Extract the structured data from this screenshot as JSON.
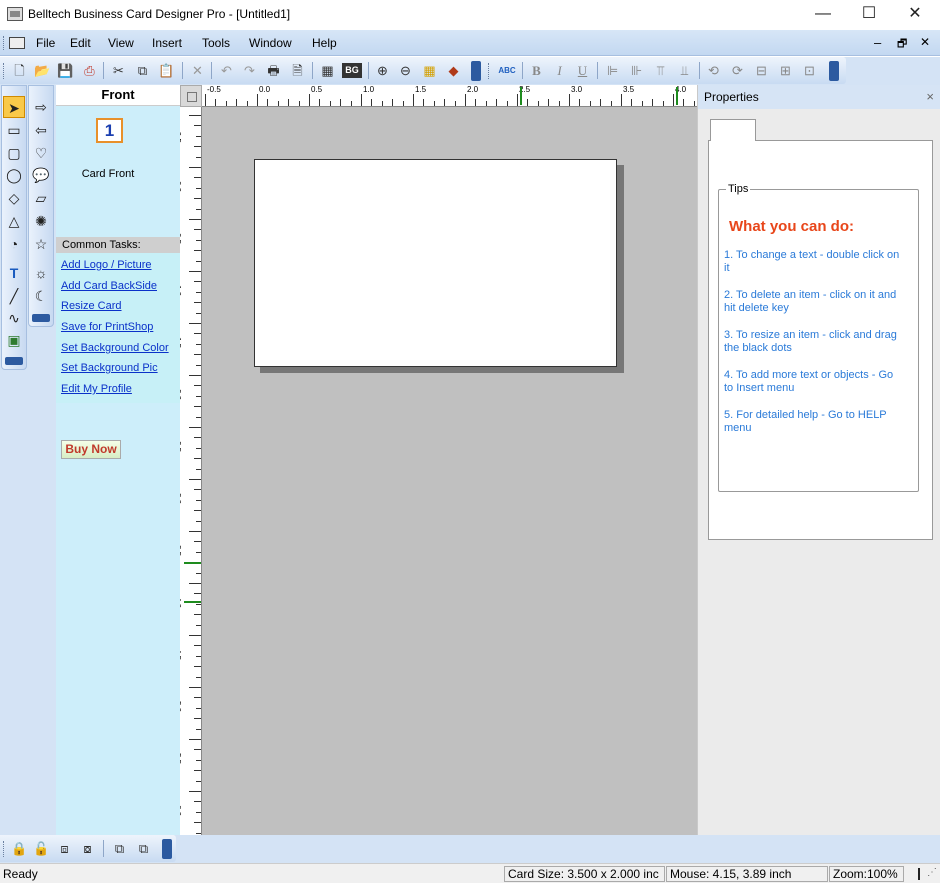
{
  "window": {
    "title": "Belltech Business Card Designer Pro  - [Untitled1]",
    "controls": {
      "minimize": "—",
      "maximize": "☐",
      "close": "✕"
    }
  },
  "menubar": {
    "items": [
      "File",
      "Edit",
      "View",
      "Insert",
      "Tools",
      "Window",
      "Help"
    ],
    "mdi_controls": {
      "minimize": "–",
      "restore": "🗗",
      "close": "✕"
    }
  },
  "toolbar": {
    "icons": [
      "new-icon",
      "open-icon",
      "save-icon",
      "pdf-icon",
      "cut-icon",
      "copy-icon",
      "paste-icon",
      "delete-icon",
      "undo-icon",
      "redo-icon",
      "print-icon",
      "print-preview-icon",
      "card-layout-icon",
      "background-icon",
      "zoom-in-icon",
      "zoom-out-icon",
      "grid-icon",
      "fill-icon",
      "spellcheck-icon",
      "bold-icon",
      "italic-icon",
      "underline-icon",
      "align-left-icon",
      "align-right-icon",
      "align-top-icon",
      "align-bottom-icon",
      "rotate-left-icon",
      "rotate-right-icon",
      "center-h-icon",
      "center-v-icon",
      "center-both-icon"
    ],
    "format_labels": {
      "spell": "ABC",
      "bold": "B",
      "italic": "I",
      "underline": "U"
    }
  },
  "drawing_tools": {
    "col1": [
      "pointer-icon",
      "rectangle-icon",
      "rounded-rectangle-icon",
      "ellipse-icon",
      "diamond-icon",
      "triangle-icon",
      "arc-icon",
      "text-icon",
      "line-icon",
      "curve-icon",
      "image-icon"
    ],
    "col2": [
      "arrow-right-icon",
      "arrow-left-icon",
      "callout-icon",
      "speech-bubble-icon",
      "parallelogram-icon",
      "burst-icon",
      "star-icon",
      "sun-icon",
      "moon-icon"
    ],
    "text_tool_label": "T"
  },
  "side_panel": {
    "header": "Front",
    "thumbnail": {
      "number": "1",
      "label": "Card Front"
    },
    "tasks_header": "Common Tasks:",
    "tasks": [
      "Add Logo / Picture",
      "Add Card BackSide",
      "Resize Card",
      "Save for PrintShop",
      "Set Background Color",
      "Set Background Pic",
      "Edit My Profile"
    ],
    "buy_now": "Buy Now"
  },
  "rulers": {
    "horizontal": [
      "-0.5",
      "0.0",
      "0.5",
      "1.0",
      "1.5",
      "2.0",
      "2.5",
      "3.0",
      "3.5",
      "4.0"
    ],
    "vertical": [
      "-0.5",
      "0.0",
      "0.5",
      "1.0",
      "1.5",
      "2.0",
      "2.5",
      "3.0",
      "3.5",
      "4.0",
      "4.5",
      "5.0",
      "5.5",
      "6.0"
    ]
  },
  "properties": {
    "title": "Properties",
    "close": "×",
    "tips_legend": "Tips",
    "tips_heading": "What you can do:",
    "tips": [
      "1. To change a text - double click on it",
      "2. To delete an item - click on it and hit delete key",
      "3. To resize an item - click and drag the black dots",
      "4. To add more text or objects - Go to Insert menu",
      "5. For detailed help - Go to HELP menu"
    ]
  },
  "bottom_toolbar": {
    "icons": [
      "lock-icon",
      "unlock-icon",
      "group-icon",
      "ungroup-icon",
      "bring-front-icon",
      "send-back-icon"
    ]
  },
  "statusbar": {
    "ready": "Ready",
    "card_size": "Card Size: 3.500 x 2.000 inc",
    "mouse": "Mouse: 4.15, 3.89 inch",
    "zoom": "Zoom:100%"
  }
}
